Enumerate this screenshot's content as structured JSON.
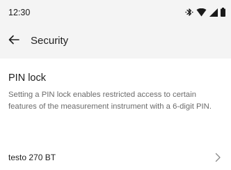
{
  "status_bar": {
    "time": "12:30",
    "icons": [
      "bluetooth-icon",
      "wifi-icon",
      "signal-icon",
      "battery-icon"
    ]
  },
  "app_bar": {
    "back_icon": "arrow-left-icon",
    "title": "Security"
  },
  "pin_lock": {
    "title": "PIN lock",
    "description": "Setting a PIN lock enables restricted access to certain features of the measurement instrument with a 6-digit PIN."
  },
  "devices": [
    {
      "label": "testo 270 BT",
      "icon": "chevron-right-icon"
    }
  ],
  "colors": {
    "header_bg": "#f4f4f4",
    "text_primary": "#1e1e1e",
    "text_secondary": "#6b6b6b",
    "chevron": "#8a8a8a"
  }
}
